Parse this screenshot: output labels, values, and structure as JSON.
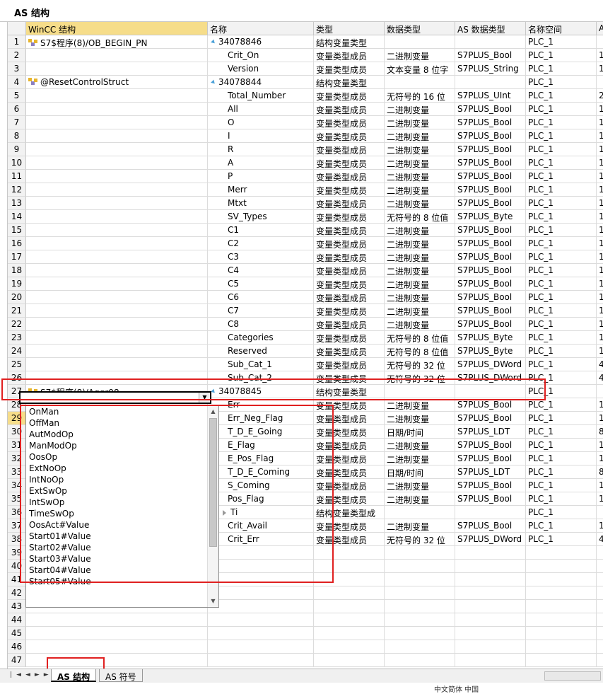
{
  "window_title": "AS 结构",
  "columns": [
    "WinCC 结构",
    "名称",
    "类型",
    "数据类型",
    "AS 数据类型",
    "名称空间",
    "A"
  ],
  "rows": [
    {
      "n": "1",
      "icon": true,
      "c0": "S7$程序(8)/OB_BEGIN_PN",
      "tri": true,
      "c1": "34078846",
      "c2": "结构变量类型",
      "c3": "",
      "c4": "",
      "c5": "PLC_1",
      "c6": ""
    },
    {
      "n": "2",
      "c0": "",
      "c1": "Crit_On",
      "mbr": true,
      "c2": "变量类型成员",
      "c3": "二进制变量",
      "c4": "S7PLUS_Bool",
      "c5": "PLC_1",
      "c6": "1"
    },
    {
      "n": "3",
      "c0": "",
      "c1": "Version",
      "mbr": true,
      "c2": "变量类型成员",
      "c3": "文本变量 8 位字",
      "c4": "S7PLUS_String",
      "c5": "PLC_1",
      "c6": "1"
    },
    {
      "n": "4",
      "icon": true,
      "c0": "@ResetControlStruct",
      "tri": true,
      "c1": "34078844",
      "c2": "结构变量类型",
      "c3": "",
      "c4": "",
      "c5": "PLC_1",
      "c6": ""
    },
    {
      "n": "5",
      "c0": "",
      "c1": "Total_Number",
      "mbr": true,
      "c2": "变量类型成员",
      "c3": "无符号的 16 位",
      "c4": "S7PLUS_UInt",
      "c5": "PLC_1",
      "c6": "2"
    },
    {
      "n": "6",
      "c0": "",
      "c1": "All",
      "mbr": true,
      "c2": "变量类型成员",
      "c3": "二进制变量",
      "c4": "S7PLUS_Bool",
      "c5": "PLC_1",
      "c6": "1"
    },
    {
      "n": "7",
      "c0": "",
      "c1": "O",
      "mbr": true,
      "c2": "变量类型成员",
      "c3": "二进制变量",
      "c4": "S7PLUS_Bool",
      "c5": "PLC_1",
      "c6": "1"
    },
    {
      "n": "8",
      "c0": "",
      "c1": "I",
      "mbr": true,
      "c2": "变量类型成员",
      "c3": "二进制变量",
      "c4": "S7PLUS_Bool",
      "c5": "PLC_1",
      "c6": "1"
    },
    {
      "n": "9",
      "c0": "",
      "c1": "R",
      "mbr": true,
      "c2": "变量类型成员",
      "c3": "二进制变量",
      "c4": "S7PLUS_Bool",
      "c5": "PLC_1",
      "c6": "1"
    },
    {
      "n": "10",
      "c0": "",
      "c1": "A",
      "mbr": true,
      "c2": "变量类型成员",
      "c3": "二进制变量",
      "c4": "S7PLUS_Bool",
      "c5": "PLC_1",
      "c6": "1"
    },
    {
      "n": "11",
      "c0": "",
      "c1": "P",
      "mbr": true,
      "c2": "变量类型成员",
      "c3": "二进制变量",
      "c4": "S7PLUS_Bool",
      "c5": "PLC_1",
      "c6": "1"
    },
    {
      "n": "12",
      "c0": "",
      "c1": "Merr",
      "mbr": true,
      "c2": "变量类型成员",
      "c3": "二进制变量",
      "c4": "S7PLUS_Bool",
      "c5": "PLC_1",
      "c6": "1"
    },
    {
      "n": "13",
      "c0": "",
      "c1": "Mtxt",
      "mbr": true,
      "c2": "变量类型成员",
      "c3": "二进制变量",
      "c4": "S7PLUS_Bool",
      "c5": "PLC_1",
      "c6": "1"
    },
    {
      "n": "14",
      "c0": "",
      "c1": "SV_Types",
      "mbr": true,
      "c2": "变量类型成员",
      "c3": "无符号的 8 位值",
      "c4": "S7PLUS_Byte",
      "c5": "PLC_1",
      "c6": "1"
    },
    {
      "n": "15",
      "c0": "",
      "c1": "C1",
      "mbr": true,
      "c2": "变量类型成员",
      "c3": "二进制变量",
      "c4": "S7PLUS_Bool",
      "c5": "PLC_1",
      "c6": "1"
    },
    {
      "n": "16",
      "c0": "",
      "c1": "C2",
      "mbr": true,
      "c2": "变量类型成员",
      "c3": "二进制变量",
      "c4": "S7PLUS_Bool",
      "c5": "PLC_1",
      "c6": "1"
    },
    {
      "n": "17",
      "c0": "",
      "c1": "C3",
      "mbr": true,
      "c2": "变量类型成员",
      "c3": "二进制变量",
      "c4": "S7PLUS_Bool",
      "c5": "PLC_1",
      "c6": "1"
    },
    {
      "n": "18",
      "c0": "",
      "c1": "C4",
      "mbr": true,
      "c2": "变量类型成员",
      "c3": "二进制变量",
      "c4": "S7PLUS_Bool",
      "c5": "PLC_1",
      "c6": "1"
    },
    {
      "n": "19",
      "c0": "",
      "c1": "C5",
      "mbr": true,
      "c2": "变量类型成员",
      "c3": "二进制变量",
      "c4": "S7PLUS_Bool",
      "c5": "PLC_1",
      "c6": "1"
    },
    {
      "n": "20",
      "c0": "",
      "c1": "C6",
      "mbr": true,
      "c2": "变量类型成员",
      "c3": "二进制变量",
      "c4": "S7PLUS_Bool",
      "c5": "PLC_1",
      "c6": "1"
    },
    {
      "n": "21",
      "c0": "",
      "c1": "C7",
      "mbr": true,
      "c2": "变量类型成员",
      "c3": "二进制变量",
      "c4": "S7PLUS_Bool",
      "c5": "PLC_1",
      "c6": "1"
    },
    {
      "n": "22",
      "c0": "",
      "c1": "C8",
      "mbr": true,
      "c2": "变量类型成员",
      "c3": "二进制变量",
      "c4": "S7PLUS_Bool",
      "c5": "PLC_1",
      "c6": "1"
    },
    {
      "n": "23",
      "c0": "",
      "c1": "Categories",
      "mbr": true,
      "c2": "变量类型成员",
      "c3": "无符号的 8 位值",
      "c4": "S7PLUS_Byte",
      "c5": "PLC_1",
      "c6": "1"
    },
    {
      "n": "24",
      "c0": "",
      "c1": "Reserved",
      "mbr": true,
      "c2": "变量类型成员",
      "c3": "无符号的 8 位值",
      "c4": "S7PLUS_Byte",
      "c5": "PLC_1",
      "c6": "1"
    },
    {
      "n": "25",
      "c0": "",
      "c1": "Sub_Cat_1",
      "mbr": true,
      "c2": "变量类型成员",
      "c3": "无符号的 32 位",
      "c4": "S7PLUS_DWord",
      "c5": "PLC_1",
      "c6": "4"
    },
    {
      "n": "26",
      "c0": "",
      "c1": "Sub_Cat_2",
      "mbr": true,
      "c2": "变量类型成员",
      "c3": "无符号的 32 位",
      "c4": "S7PLUS_DWord",
      "c5": "PLC_1",
      "c6": "4"
    },
    {
      "n": "27",
      "icon": true,
      "c0": "S7$程序(8)/Aggr08",
      "tri": true,
      "c1": "34078845",
      "c2": "结构变量类型",
      "c3": "",
      "c4": "",
      "c5": "PLC_1",
      "c6": ""
    },
    {
      "n": "28",
      "c0": "",
      "c1": "Err",
      "mbr": true,
      "c2": "变量类型成员",
      "c3": "二进制变量",
      "c4": "S7PLUS_Bool",
      "c5": "PLC_1",
      "c6": "1"
    },
    {
      "n": "29",
      "active": true,
      "c0": "",
      "c1": "Err_Neg_Flag",
      "mbr": true,
      "c2": "变量类型成员",
      "c3": "二进制变量",
      "c4": "S7PLUS_Bool",
      "c5": "PLC_1",
      "c6": "1"
    },
    {
      "n": "30",
      "c0": "",
      "c1": "T_D_E_Going",
      "mbr": true,
      "c2": "变量类型成员",
      "c3": "日期/时间",
      "c4": "S7PLUS_LDT",
      "c5": "PLC_1",
      "c6": "8"
    },
    {
      "n": "31",
      "c0": "",
      "c1": "E_Flag",
      "mbr": true,
      "c2": "变量类型成员",
      "c3": "二进制变量",
      "c4": "S7PLUS_Bool",
      "c5": "PLC_1",
      "c6": "1"
    },
    {
      "n": "32",
      "c0": "",
      "c1": "E_Pos_Flag",
      "mbr": true,
      "c2": "变量类型成员",
      "c3": "二进制变量",
      "c4": "S7PLUS_Bool",
      "c5": "PLC_1",
      "c6": "1"
    },
    {
      "n": "33",
      "c0": "",
      "c1": "T_D_E_Coming",
      "mbr": true,
      "c2": "变量类型成员",
      "c3": "日期/时间",
      "c4": "S7PLUS_LDT",
      "c5": "PLC_1",
      "c6": "8"
    },
    {
      "n": "34",
      "c0": "",
      "c1": "S_Coming",
      "mbr": true,
      "c2": "变量类型成员",
      "c3": "二进制变量",
      "c4": "S7PLUS_Bool",
      "c5": "PLC_1",
      "c6": "1"
    },
    {
      "n": "35",
      "c0": "",
      "c1": "Pos_Flag",
      "mbr": true,
      "c2": "变量类型成员",
      "c3": "二进制变量",
      "c4": "S7PLUS_Bool",
      "c5": "PLC_1",
      "c6": "1"
    },
    {
      "n": "36",
      "c0": "",
      "c1": "Ti",
      "tri2": true,
      "c2": "结构变量类型成",
      "c3": "",
      "c4": "",
      "c5": "PLC_1",
      "c6": ""
    },
    {
      "n": "37",
      "c0": "",
      "c1": "Crit_Avail",
      "mbr": true,
      "c2": "变量类型成员",
      "c3": "二进制变量",
      "c4": "S7PLUS_Bool",
      "c5": "PLC_1",
      "c6": "1"
    },
    {
      "n": "38",
      "c0": "",
      "c1": "Crit_Err",
      "mbr": true,
      "c2": "变量类型成员",
      "c3": "无符号的 32 位",
      "c4": "S7PLUS_DWord",
      "c5": "PLC_1",
      "c6": "4"
    },
    {
      "n": "39",
      "c0": "",
      "c1": "",
      "c2": "",
      "c3": "",
      "c4": "",
      "c5": "",
      "c6": ""
    },
    {
      "n": "40",
      "c0": "",
      "c1": "",
      "c2": "",
      "c3": "",
      "c4": "",
      "c5": "",
      "c6": ""
    },
    {
      "n": "41",
      "c0": "",
      "c1": "",
      "c2": "",
      "c3": "",
      "c4": "",
      "c5": "",
      "c6": ""
    },
    {
      "n": "42",
      "c0": "",
      "c1": "",
      "c2": "",
      "c3": "",
      "c4": "",
      "c5": "",
      "c6": ""
    },
    {
      "n": "43",
      "c0": "",
      "c1": "",
      "c2": "",
      "c3": "",
      "c4": "",
      "c5": "",
      "c6": ""
    },
    {
      "n": "44",
      "c0": "",
      "c1": "",
      "c2": "",
      "c3": "",
      "c4": "",
      "c5": "",
      "c6": ""
    },
    {
      "n": "45",
      "c0": "",
      "c1": "",
      "c2": "",
      "c3": "",
      "c4": "",
      "c5": "",
      "c6": ""
    },
    {
      "n": "46",
      "c0": "",
      "c1": "",
      "c2": "",
      "c3": "",
      "c4": "",
      "c5": "",
      "c6": ""
    },
    {
      "n": "47",
      "c0": "",
      "c1": "",
      "c2": "",
      "c3": "",
      "c4": "",
      "c5": "",
      "c6": ""
    }
  ],
  "dropdown": {
    "edit_value": "",
    "arrow_icon": "chevron-down-icon",
    "items": [
      "OnMan",
      "OffMan",
      "AutModOp",
      "ManModOp",
      "OosOp",
      "ExtNoOp",
      "IntNoOp",
      "ExtSwOp",
      "IntSwOp",
      "TimeSwOp",
      "OosAct#Value",
      "Start01#Value",
      "Start02#Value",
      "Start03#Value",
      "Start04#Value",
      "Start05#Value"
    ]
  },
  "sheet_tabs": [
    "AS 结构",
    "AS 符号"
  ],
  "status_text": "中文简体 中国",
  "accent_colors": {
    "highlight": "#f6dd8a",
    "annotation": "#e02020"
  }
}
